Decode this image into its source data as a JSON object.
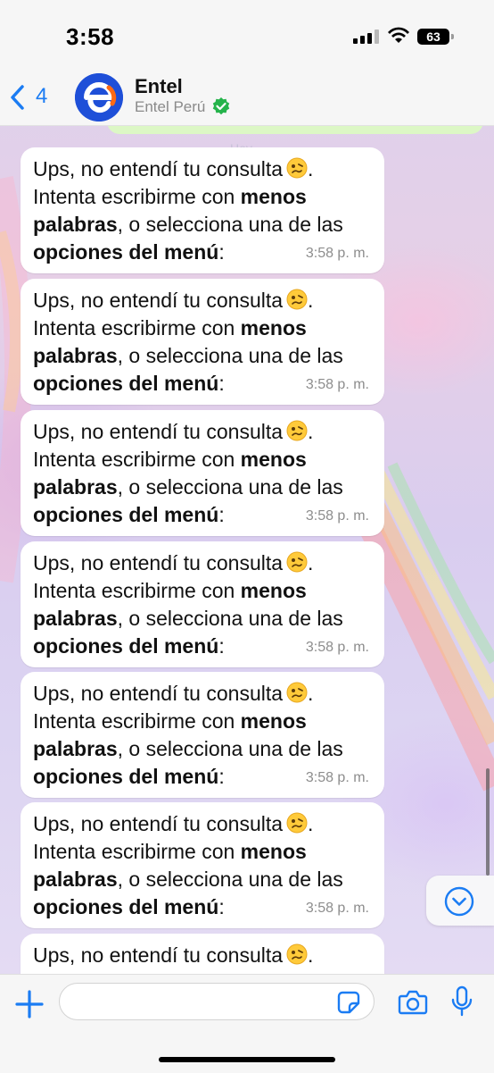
{
  "status_bar": {
    "time": "3:58",
    "battery": "63"
  },
  "header": {
    "back_count": "4",
    "contact_name": "Entel",
    "contact_subtitle": "Entel Perú"
  },
  "day_chip": "Hoy",
  "messages": [
    {
      "line1": "Ups, no entendí tu consulta",
      "line2_a": "Intenta escribirme con ",
      "line2_b": "menos",
      "line3_a": "palabras",
      "line3_b": ", o selecciona una de las",
      "line4_a": "opciones del menú",
      "line4_b": ":",
      "time": "3:58 p. m."
    },
    {
      "line1": "Ups, no entendí tu consulta",
      "line2_a": "Intenta escribirme con ",
      "line2_b": "menos",
      "line3_a": "palabras",
      "line3_b": ", o selecciona una de las",
      "line4_a": "opciones del menú",
      "line4_b": ":",
      "time": "3:58 p. m."
    },
    {
      "line1": "Ups, no entendí tu consulta",
      "line2_a": "Intenta escribirme con ",
      "line2_b": "menos",
      "line3_a": "palabras",
      "line3_b": ", o selecciona una de las",
      "line4_a": "opciones del menú",
      "line4_b": ":",
      "time": "3:58 p. m."
    },
    {
      "line1": "Ups, no entendí tu consulta",
      "line2_a": "Intenta escribirme con ",
      "line2_b": "menos",
      "line3_a": "palabras",
      "line3_b": ", o selecciona una de las",
      "line4_a": "opciones del menú",
      "line4_b": ":",
      "time": "3:58 p. m."
    },
    {
      "line1": "Ups, no entendí tu consulta",
      "line2_a": "Intenta escribirme con ",
      "line2_b": "menos",
      "line3_a": "palabras",
      "line3_b": ", o selecciona una de las",
      "line4_a": "opciones del menú",
      "line4_b": ":",
      "time": "3:58 p. m."
    },
    {
      "line1": "Ups, no entendí tu consulta",
      "line2_a": "Intenta escribirme con ",
      "line2_b": "menos",
      "line3_a": "palabras",
      "line3_b": ", o selecciona una de las",
      "line4_a": "opciones del menú",
      "line4_b": ":",
      "time": "3:58 p. m."
    },
    {
      "line1": "Ups, no entendí tu consulta"
    }
  ],
  "input": {
    "placeholder": ""
  },
  "icons": {
    "back": "chevron-left-icon",
    "verified": "verified-badge-icon",
    "emoji": "woozy-face-emoji",
    "scroll_down": "chevron-down-circle-icon",
    "attach": "plus-icon",
    "sticker": "sticker-icon",
    "camera": "camera-icon",
    "mic": "microphone-icon"
  },
  "colors": {
    "accent": "#1b7cf3",
    "verified": "#25b34b",
    "brand": "#1e4fd8",
    "brand_secondary": "#ff6a13"
  }
}
